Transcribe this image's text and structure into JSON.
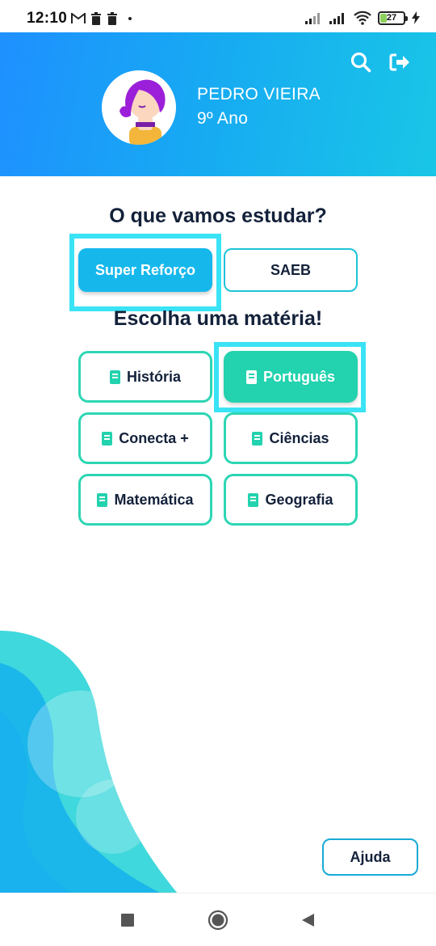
{
  "status_bar": {
    "time": "12:10",
    "battery_level": "27",
    "left_icons": [
      "gmail-icon",
      "trash-icon",
      "trash-icon",
      "dot-icon"
    ],
    "right_icons": [
      "signal-icon",
      "signal-icon",
      "wifi-icon",
      "battery-icon",
      "charging-icon"
    ]
  },
  "header": {
    "student_name": "PEDRO VIEIRA",
    "student_grade": "9º Ano",
    "search_icon": "search-icon",
    "logout_icon": "logout-icon",
    "gradient_colors": [
      "#1e90ff",
      "#19c6e6"
    ]
  },
  "study_section": {
    "heading": "O que vamos estudar?",
    "modes": [
      {
        "label": "Super Reforço",
        "active": true
      },
      {
        "label": "SAEB",
        "active": false
      }
    ]
  },
  "subject_section": {
    "heading": "Escolha uma matéria!",
    "subjects": [
      {
        "label": "História",
        "selected": false
      },
      {
        "label": "Português",
        "selected": true
      },
      {
        "label": "Conecta +",
        "selected": false
      },
      {
        "label": "Ciências",
        "selected": false
      },
      {
        "label": "Matemática",
        "selected": false
      },
      {
        "label": "Geografia",
        "selected": false
      }
    ]
  },
  "help_button": {
    "label": "Ajuda"
  },
  "nav_bar": {
    "icons": [
      "recents-icon",
      "home-icon",
      "back-icon"
    ]
  },
  "colors": {
    "primary_blue": "#16b8ec",
    "teal": "#23d2ae",
    "highlight": "#3ae3f5",
    "text_dark": "#13213a"
  }
}
